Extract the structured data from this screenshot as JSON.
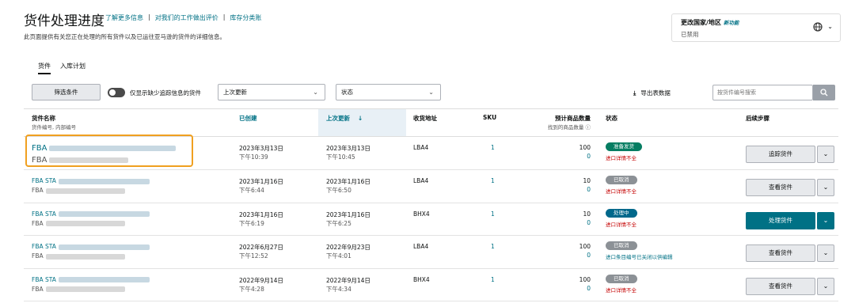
{
  "header": {
    "title": "货件处理进度",
    "links": [
      "了解更多信息",
      "对我们的工作做出评价",
      "库存分类账"
    ],
    "separator": "|",
    "description": "此页面提供有关您正在处理的所有货件以及已运往亚马逊的货件的详细信息。"
  },
  "country": {
    "title": "更改国家/地区",
    "new_badge": "新功能",
    "status": "已禁用",
    "caret": "⌄"
  },
  "tabs": [
    "货件",
    "入库计划"
  ],
  "toolbar": {
    "filter_label": "筛选条件",
    "toggle_label": "仅显示缺少追踪信息的货件",
    "sort_value": "上次更新",
    "status_value": "状态",
    "export_label": "导出表数据",
    "search_placeholder": "按货件编号搜索"
  },
  "columns": {
    "name": "货件名称",
    "name_sub": "货件编号, 内部编号",
    "created": "已创建",
    "updated": "上次更新",
    "address": "收货地址",
    "sku": "SKU",
    "qty": "预计商品数量",
    "qty_sub": "找到的商品数量 ⓘ",
    "status": "状态",
    "next": "后续步骤"
  },
  "rows": [
    {
      "name1": "FBA",
      "name2": "FBA",
      "created_date": "2023年3月13日",
      "created_time": "下午10:39",
      "updated_date": "2023年3月13日",
      "updated_time": "下午10:45",
      "address": "LBA4",
      "sku": "1",
      "qty": "100",
      "found": "0",
      "status": "准备发货",
      "note": "进口详情不全",
      "action": "追踪货件"
    },
    {
      "name1": "FBA STA",
      "name2": "FBA",
      "created_date": "2023年1月16日",
      "created_time": "下午6:44",
      "updated_date": "2023年1月16日",
      "updated_time": "下午6:50",
      "address": "LBA4",
      "sku": "1",
      "qty": "10",
      "found": "0",
      "status": "已取消",
      "note": "进口详情不全",
      "action": "查看货件"
    },
    {
      "name1": "FBA STA",
      "name2": "FBA",
      "created_date": "2023年1月16日",
      "created_time": "下午6:19",
      "updated_date": "2023年1月16日",
      "updated_time": "下午6:25",
      "address": "BHX4",
      "sku": "1",
      "qty": "10",
      "found": "0",
      "status": "处理中",
      "note": "进口详情不全",
      "action": "处理货件"
    },
    {
      "name1": "FBA STA",
      "name2": "FBA",
      "created_date": "2022年6月27日",
      "created_time": "下午12:52",
      "updated_date": "2022年9月23日",
      "updated_time": "下午4:01",
      "address": "LBA4",
      "sku": "1",
      "qty": "100",
      "found": "0",
      "status": "已取消",
      "note": "进口条目编号已关闭以供编辑",
      "action": "查看货件"
    },
    {
      "name1": "FBA STA",
      "name2": "FBA",
      "created_date": "2022年9月14日",
      "created_time": "下午4:28",
      "updated_date": "2022年9月14日",
      "updated_time": "下午4:34",
      "address": "BHX4",
      "sku": "1",
      "qty": "100",
      "found": "0",
      "status": "已取消",
      "note": "进口详情不全",
      "action": "查看货件"
    }
  ]
}
